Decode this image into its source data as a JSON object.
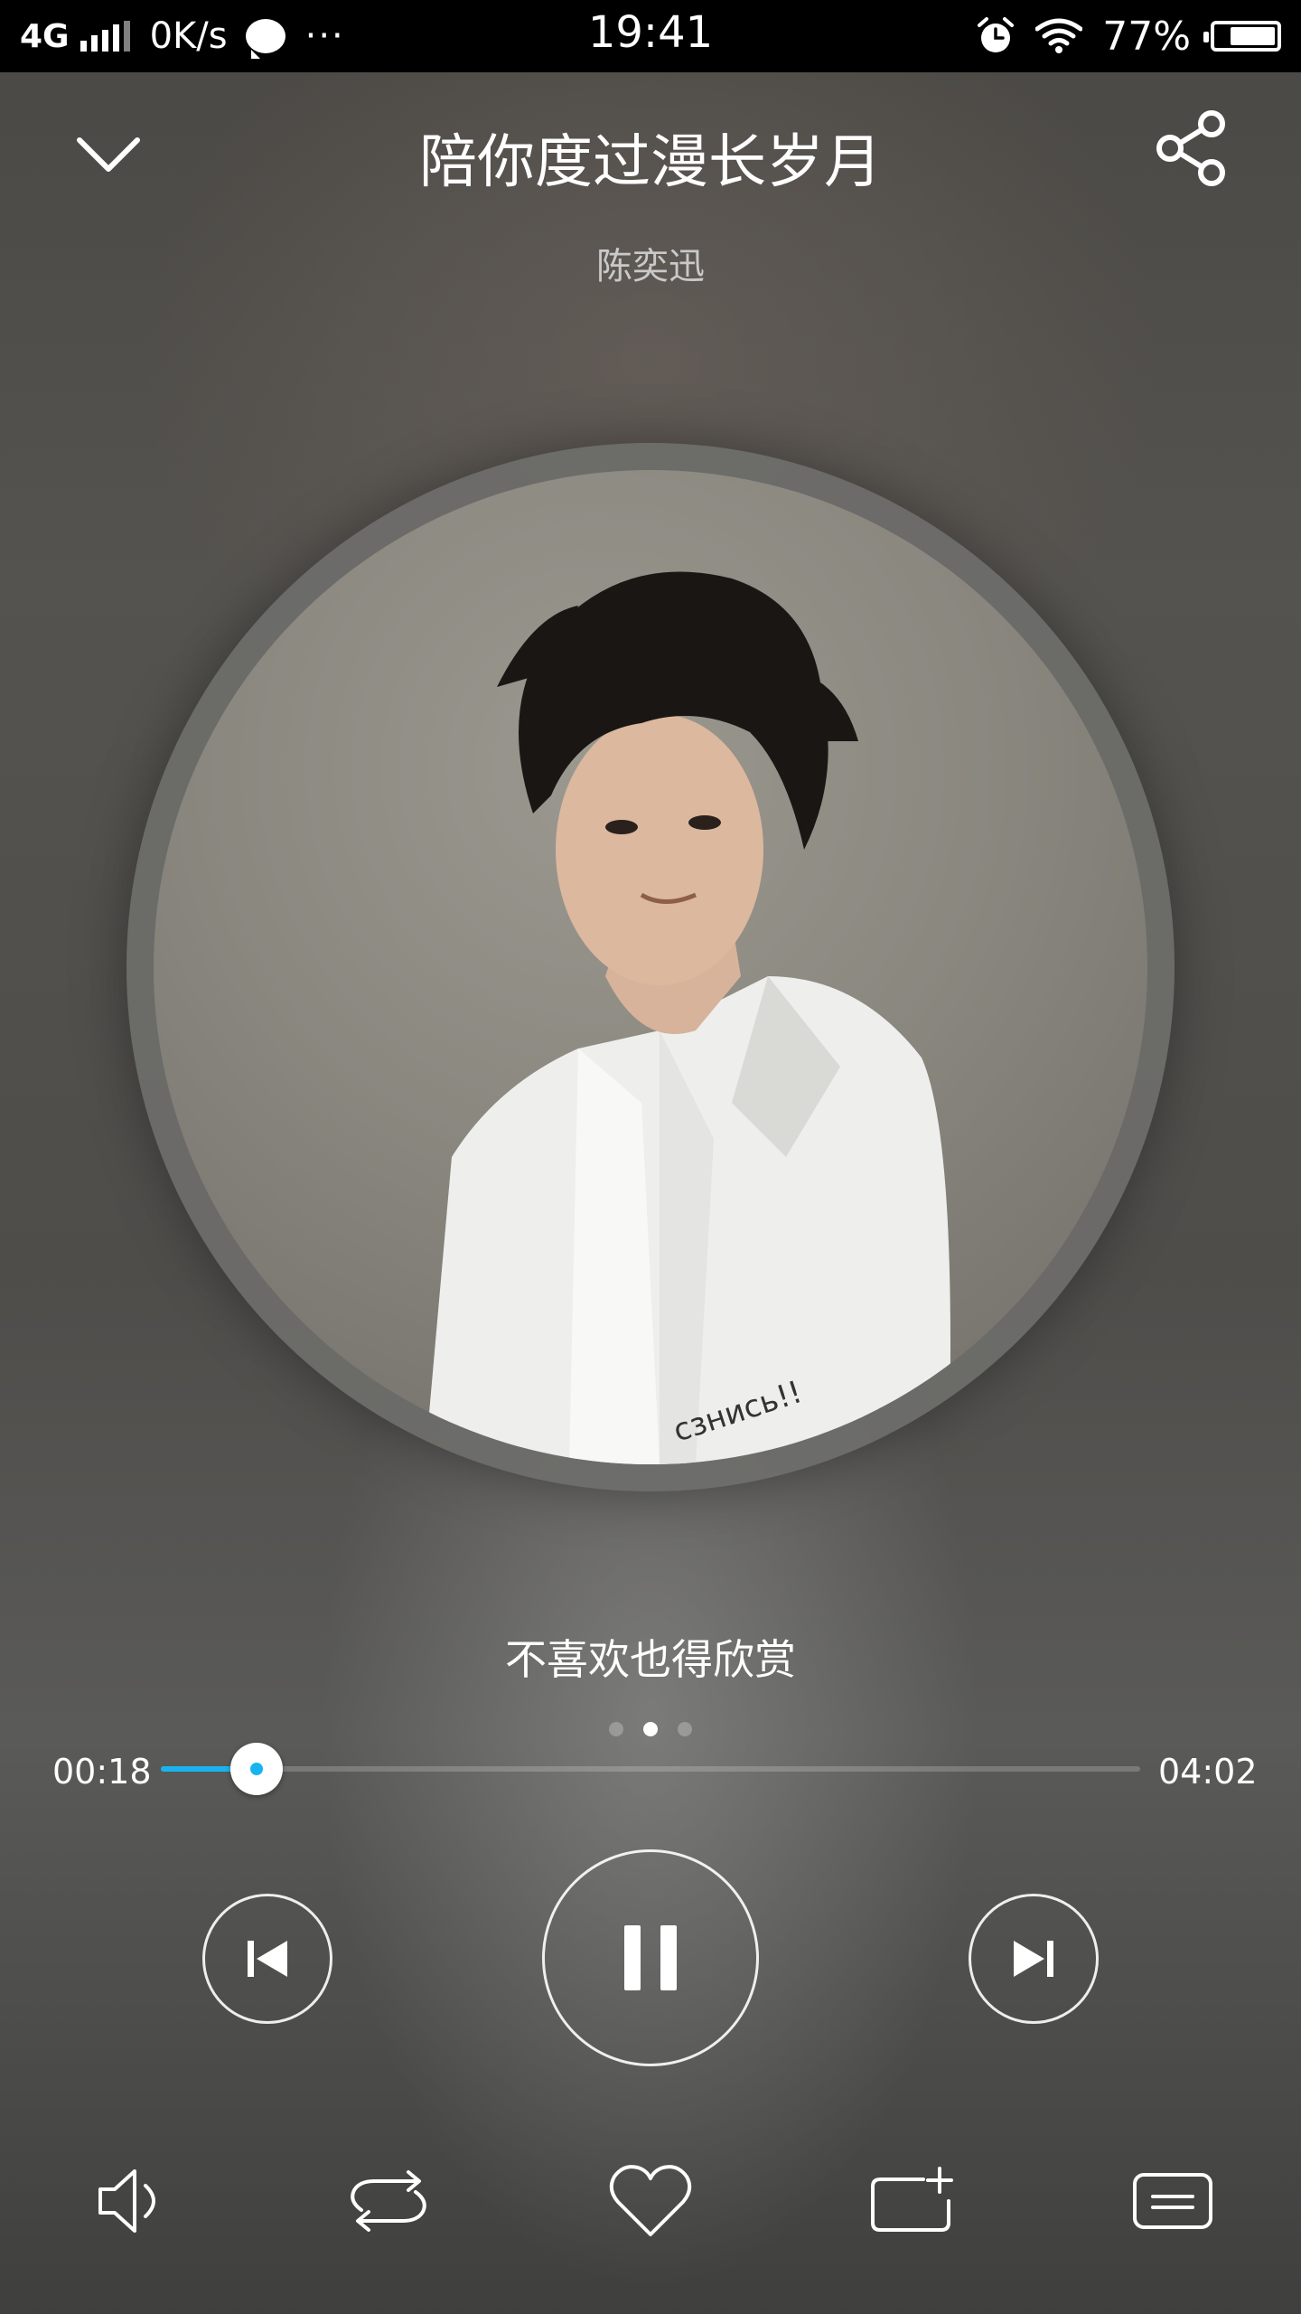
{
  "status_bar": {
    "network": "4G",
    "speed": "0K/s",
    "more": "···",
    "time": "19:41",
    "battery_text": "77%",
    "battery_level": 0.77,
    "icons": [
      "signal-icon",
      "chat-icon",
      "alarm-icon",
      "wifi-icon",
      "battery-icon"
    ]
  },
  "header": {
    "title": "陪你度过漫长岁月",
    "artist": "陈奕迅",
    "back_icon": "chevron-down-icon",
    "share_icon": "share-icon"
  },
  "album": {
    "art": "album-cover-portrait"
  },
  "lyric": {
    "current_line": "不喜欢也得欣赏"
  },
  "pager": {
    "count": 3,
    "active_index": 1
  },
  "progress": {
    "current": "00:18",
    "total": "04:02",
    "fraction": 0.098
  },
  "controls": {
    "prev_icon": "skip-previous-icon",
    "play_pause_icon": "pause-icon",
    "next_icon": "skip-next-icon"
  },
  "bottom_bar": {
    "items": [
      "volume-icon",
      "repeat-icon",
      "heart-icon",
      "add-to-playlist-icon",
      "playlist-icon"
    ]
  },
  "colors": {
    "accent": "#19b4f0",
    "status_bar_bg": "#000000",
    "artist_text": "#c9c9c9"
  }
}
